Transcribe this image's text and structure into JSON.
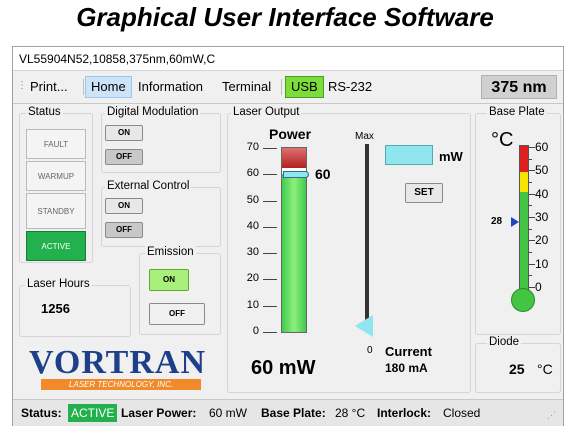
{
  "banner": {
    "title": "Graphical User Interface Software"
  },
  "window": {
    "title": "VL55904N52,10858,375nm,60mW,C"
  },
  "menu": {
    "items": [
      "Print...",
      "Home",
      "Information",
      "Terminal",
      "USB",
      "RS-232"
    ],
    "wavelength": "375 nm"
  },
  "status_group": {
    "label": "Status",
    "fault": "FAULT",
    "warmup": "WARMUP",
    "standby": "STANDBY",
    "active": "ACTIVE"
  },
  "digital_modulation": {
    "label": "Digital Modulation",
    "on": "ON",
    "off": "OFF"
  },
  "external_control": {
    "label": "External Control",
    "on": "ON",
    "off": "OFF"
  },
  "emission": {
    "label": "Emission",
    "on": "ON",
    "off": "OFF"
  },
  "laser_hours": {
    "label": "Laser Hours",
    "value": "1256"
  },
  "logo": {
    "name": "VORTRAN",
    "tagline": "LASER TECHNOLOGY, INC."
  },
  "laser_output": {
    "label": "Laser Output",
    "power_label": "Power",
    "ticks": [
      "70",
      "60",
      "50",
      "40",
      "30",
      "20",
      "10",
      "0"
    ],
    "setpoint": "60",
    "power_value": "60 mW",
    "slider_max": "Max",
    "slider_min": "0",
    "unit": "mW",
    "set_button": "SET",
    "current_label": "Current",
    "current_value": "180 mA",
    "power_level": 60,
    "power_max": 70
  },
  "base_plate": {
    "label": "Base Plate",
    "unit": "°C",
    "ticks": [
      "60",
      "50",
      "40",
      "30",
      "20",
      "10",
      "0"
    ],
    "marker": "28",
    "temp_value": 28
  },
  "diode": {
    "label": "Diode",
    "value": "25",
    "unit": "°C"
  },
  "statusbar": {
    "status_label": "Status:",
    "status_value": "ACTIVE",
    "power_label": "Laser Power:",
    "power_value": "60 mW",
    "plate_label": "Base Plate:",
    "plate_value": "28 °C",
    "interlock_label": "Interlock:",
    "interlock_value": "Closed"
  },
  "colors": {
    "active_green": "#22b14c",
    "usb_green": "#7bdc3a",
    "emission_on": "#a8f07a",
    "wl_box": "#d0d0d0",
    "slider_cyan": "#8fe6ef"
  }
}
